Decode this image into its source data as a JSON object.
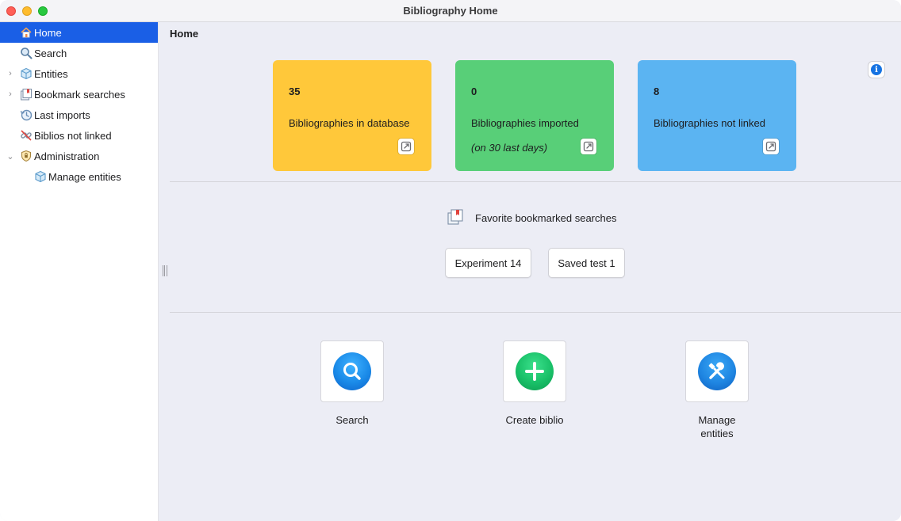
{
  "window": {
    "title": "Bibliography Home"
  },
  "sidebar": {
    "items": [
      {
        "label": "Home",
        "icon": "home-icon",
        "selected": true,
        "disclosure": ""
      },
      {
        "label": "Search",
        "icon": "search-icon",
        "selected": false,
        "disclosure": ""
      },
      {
        "label": "Entities",
        "icon": "cube-icon",
        "selected": false,
        "disclosure": "›"
      },
      {
        "label": "Bookmark searches",
        "icon": "bookmark-icon",
        "selected": false,
        "disclosure": "›"
      },
      {
        "label": "Last imports",
        "icon": "history-icon",
        "selected": false,
        "disclosure": ""
      },
      {
        "label": "Biblios not linked",
        "icon": "broken-link-icon",
        "selected": false,
        "disclosure": ""
      },
      {
        "label": "Administration",
        "icon": "shield-icon",
        "selected": false,
        "disclosure": "⌄"
      },
      {
        "label": "Manage entities",
        "icon": "cube-icon",
        "selected": false,
        "disclosure": ""
      }
    ]
  },
  "main": {
    "title": "Home",
    "stats": [
      {
        "count": "35",
        "label": "Bibliographies in database",
        "sub": "",
        "color": "#ffc83a"
      },
      {
        "count": "0",
        "label": "Bibliographies imported",
        "sub": "(on 30 last days)",
        "color": "#58cf78"
      },
      {
        "count": "8",
        "label": "Bibliographies not linked",
        "sub": "",
        "color": "#5bb4f2"
      }
    ],
    "favorites": {
      "label": "Favorite bookmarked searches",
      "buttons": [
        "Experiment 14",
        "Saved test 1"
      ]
    },
    "actions": [
      {
        "label": "Search",
        "icon": "search-icon",
        "color": "#1a8ae8"
      },
      {
        "label": "Create biblio",
        "icon": "plus-icon",
        "color": "#19c068"
      },
      {
        "label": "Manage entities",
        "icon": "tools-icon",
        "color": "#1f86e2"
      }
    ]
  }
}
